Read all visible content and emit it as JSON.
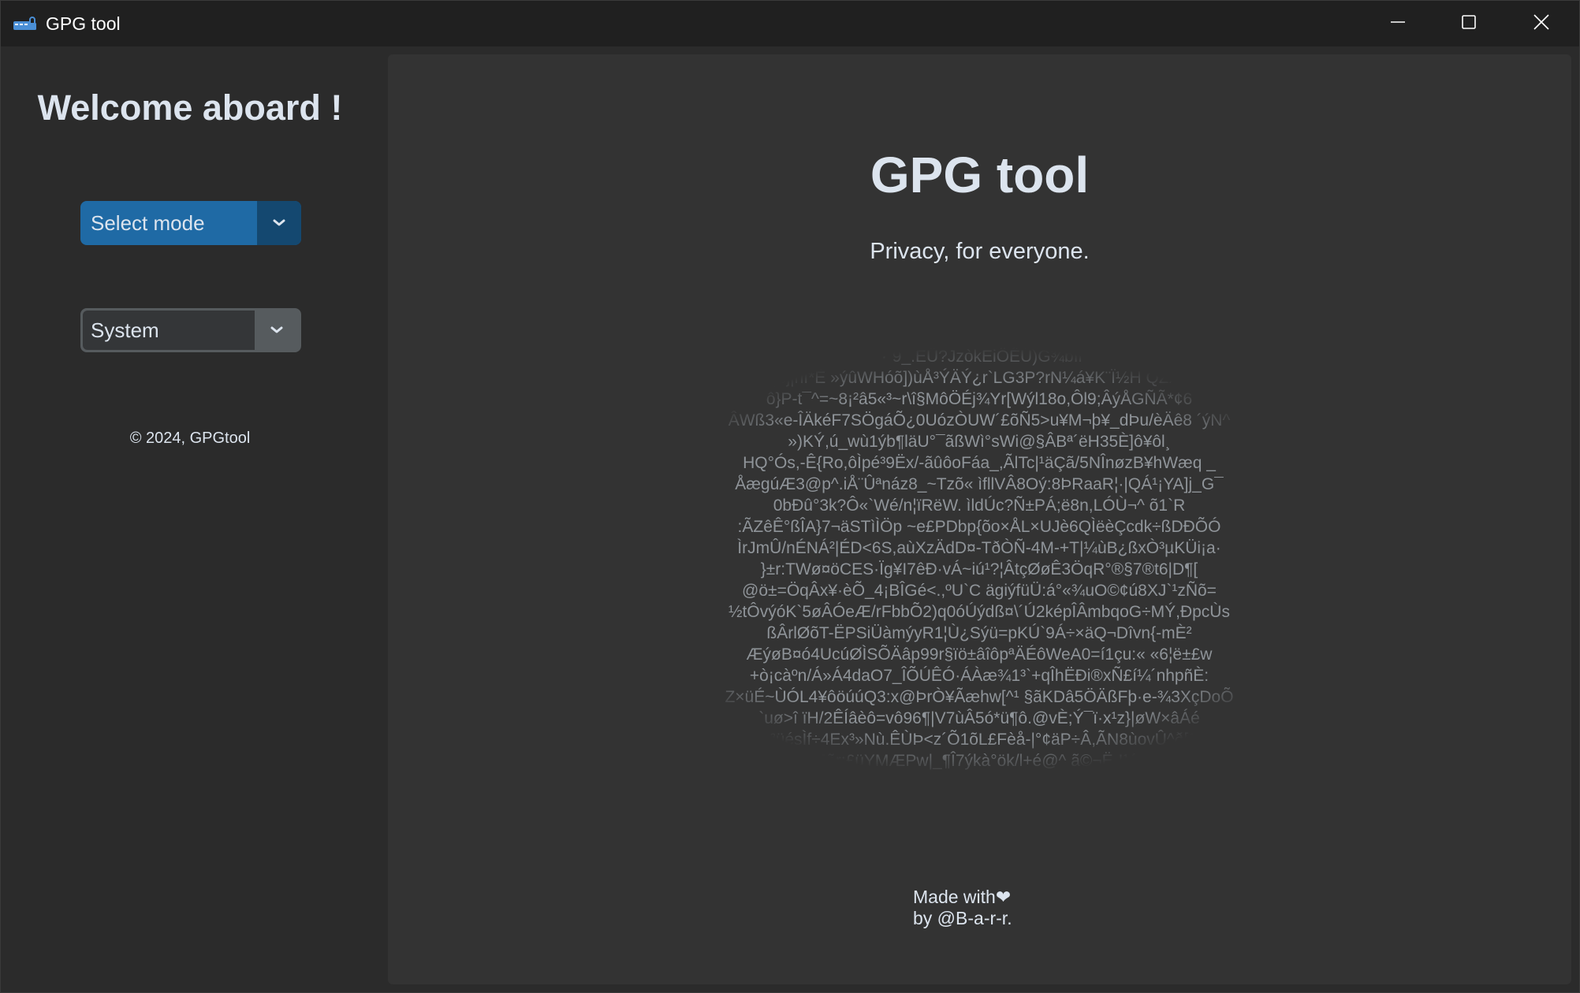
{
  "window": {
    "title": "GPG tool",
    "icon": "lock-icon"
  },
  "sidebar": {
    "welcome": "Welcome aboard !",
    "mode_select": {
      "value": "Select mode"
    },
    "theme_select": {
      "value": "System"
    },
    "copyright": "© 2024, GPGtool"
  },
  "main": {
    "title": "GPG tool",
    "subtitle": "Privacy, for everyone.",
    "cipher_lines": [
      "°·¨9_.ÉÜ?JzòkEiÖÊÚ)G¾bîr",
      "O|ßj|ñI*È »ýûWHóõ])ùÅ³ÝÄÝ¿r`LG3P?rN¼á¥K¨Ï½H QZÆv´",
      "ô}P-t¯^=~8¡²â5«³~r\\î§MôÖÉj¾Yr[Wýl18o,Ôl9;ÂýÅGÑÃ*¢6",
      "ÂWß3«e-ÎÄkéF7SÖgáÕ¿0UózÒUW´£õÑ5>u¥M¬þ¥_dÞu/èÄê8 ´ýN^",
      "»)KÝ,ú_wù1ýb¶läU°¯ãßWì°sWi@§ÂBª´ëH35È]ô¥ôl¸",
      "HQ°Ós,-Ê{Ro,ôÌpé³9Ëx/-ãûôoFáa_,ÃlTc|¹äÇã/5NÎnøzB¥hWæq _",
      "ÅægúÆ3@p^.iÅ¨Ûªnáz8_~Tzõ« ìfllVÂ8Oý:8ÞRaaR¦·|QÁ¹¡YA]j_G¯",
      "0bÐû°3k?Ô«`Wé/n¦ïRëW. ìldÚc?Ñ±PÁ;ë8n,LÓÙ¬^ õ1`R",
      ":ÃZêÊ°ßÎA}7¬äSTìÌÖp ~e£PDbp{õo×ÅL×UJè6QÌëèÇcdk÷ßDÐÕÓ",
      "ÌrJmÛ/nÉNÁ²|ÉD<6S,aùXzÄdD¤-TðÒÑ-4M-+T|¼ùB¿ßxÒ³µKÜi¡a·",
      "}±r:TWø¤öCES·Ïg¥I7êÐ·vÁ~iú¹?¦ÂtçØøÊ3ÖqR°®§7®t6|D¶[",
      "@ö±=ÖqÂx¥·èÕ_4¡BÎGé<.,ºU`C ägiýfüÜ:á°«¾uO©¢ú8XJ`¹zÑõ=",
      "½tÔvýóK`5øÂÓeÆ/rFbbÕ2)q0óÚýdß¤\\´Ú2képÎÂmbqoG÷MÝ,ÐpcÙs",
      "ßÂrlØõT-ËPSiÜàmýyR1¦Ù¿Sýü=pKÚ`9Á÷×äQ¬Dîvn{-mÈ²",
      "ÆýøB¤ó4UcúØÌSÕÄâp99r§ïö±âîôpªÄÉôWeA0=í1çu:« «6¦ë±£w",
      "+ò¡càºn/Á»Á4daO7_ÎÕÚÊÓ·ÁÀæ¾1³`+qÎhËÐi®xÑ£í¼´nhpñÈ:",
      "Z×üÉ~ÙÓL4¥ôöúúQ3:x@ÞrÒ¥Ãæhw[^¹ §ãKDâ5ÖÄßFþ·e-¾3XçDoÕ",
      "`uø>î ïH/2ÊÍâèô=vô96¶|V7ùÂ5ó*ü¶ô.@vÈ;Ý¯ï·x¹z}|øW×âÁé",
      "q³üésÌf÷4Ex³»Nù.ÊÙÞ<z´Õ1õL£Fèå-|°¢äP÷Â,ÃN8ùovÛ^ð[3",
      "~^b]*ä<øEõr;£üYMÆPw|_¶Î7ýkà°ök/l+é@^ ã©¬Ë-I¹áµ¬~¯-mý*"
    ],
    "credit_line1": "Made with❤",
    "credit_line2": "by @B-a-r-r."
  }
}
